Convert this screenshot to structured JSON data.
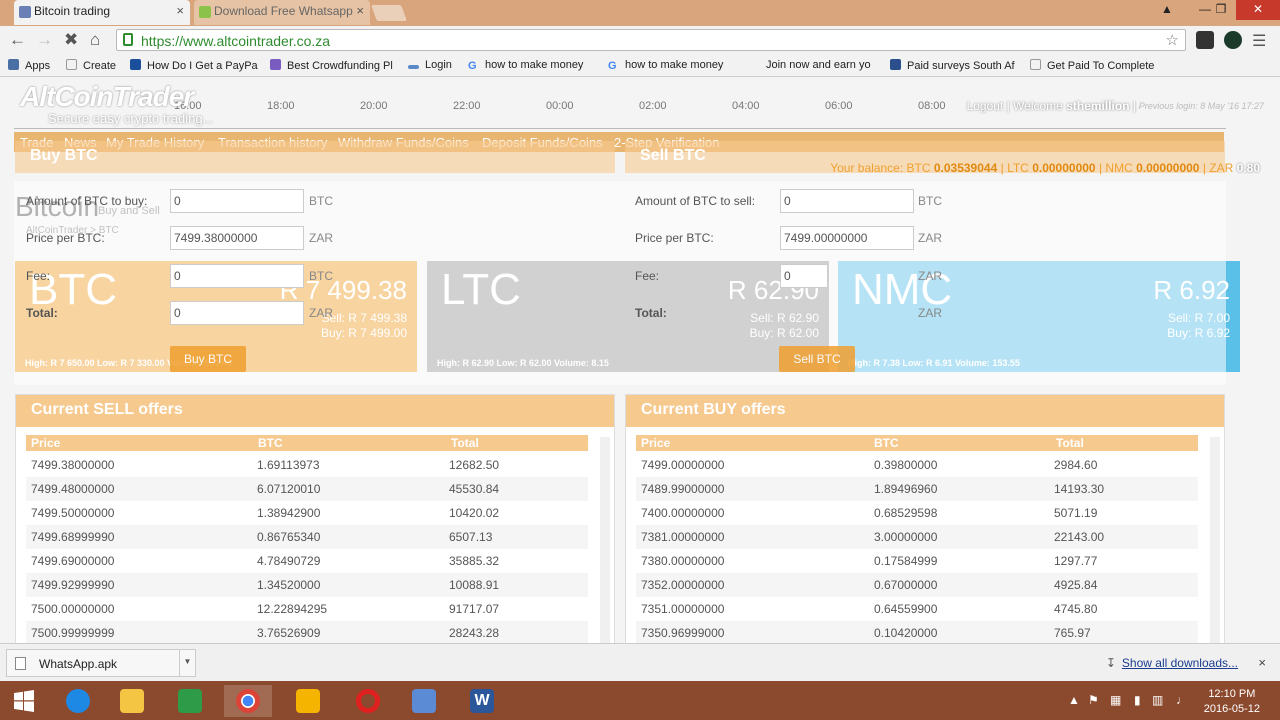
{
  "browser": {
    "tabs": [
      {
        "title": "Bitcoin trading",
        "active": true
      },
      {
        "title": "Download Free Whatsapp",
        "active": false
      }
    ],
    "close_glyph": "×",
    "url": "https://www.altcointrader.co.za",
    "bookmarks": [
      {
        "label": "Apps",
        "icon": "apps-icon"
      },
      {
        "label": "Create",
        "icon": "page-icon"
      },
      {
        "label": "How Do I Get a PayPa",
        "icon": "paypal-icon"
      },
      {
        "label": "Best Crowdfunding Pl",
        "icon": "star-icon"
      },
      {
        "label": "Login",
        "icon": "login-icon"
      },
      {
        "label": "how to make money",
        "icon": "google-icon"
      },
      {
        "label": "how to make money",
        "icon": "google-icon"
      },
      {
        "label": "Join now and earn yo",
        "icon": ""
      },
      {
        "label": "Paid surveys South Af",
        "icon": "survey-icon"
      },
      {
        "label": "Get Paid To Complete",
        "icon": "page-icon"
      }
    ]
  },
  "site": {
    "logo": "AltCoinTrader",
    "tagline": "Secure easy crypto trading...",
    "chart_ticks": [
      "16:00",
      "18:00",
      "20:00",
      "22:00",
      "00:00",
      "02:00",
      "04:00",
      "06:00",
      "08:00"
    ],
    "user_prefix": "Logout | Welcome",
    "username": "sthemillion",
    "user_suffix": "|",
    "last_login": "Previous login: 8 May '16 17:27",
    "menu": [
      "Trade",
      "News",
      "My Trade History",
      "Transaction history",
      "Withdraw Funds/Coins",
      "Deposit Funds/Coins",
      "2-Step Verification"
    ],
    "balance": {
      "prefix": "Your balance:",
      "btc_label": "BTC",
      "btc": "0.03539044",
      "ltc_label": "LTC",
      "ltc": "0.00000000",
      "nmc_label": "NMC",
      "nmc": "0.00000000",
      "zar_label": "ZAR",
      "zar": "0.80",
      "separator": "|"
    },
    "ghost": {
      "title": "Bitcoin",
      "subtitle": "Buy and Sell",
      "crumb": "AltCoinTrader > BTC"
    }
  },
  "buy_form": {
    "title": "Buy BTC",
    "amount_label": "Amount of BTC to buy:",
    "amount": "0",
    "amount_unit": "BTC",
    "price_label": "Price per BTC:",
    "price": "7499.38000000",
    "price_unit": "ZAR",
    "fee_label": "Fee:",
    "fee": "0",
    "fee_unit": "BTC",
    "total_label": "Total:",
    "total": "0",
    "total_unit": "ZAR",
    "button": "Buy BTC"
  },
  "sell_form": {
    "title": "Sell BTC",
    "amount_label": "Amount of BTC to sell:",
    "amount": "0",
    "amount_unit": "BTC",
    "price_label": "Price per BTC:",
    "price": "7499.00000000",
    "price_unit": "ZAR",
    "fee_label": "Fee:",
    "fee": "0",
    "fee_unit": "ZAR",
    "total_label": "Total:",
    "total": "0",
    "total_unit": "ZAR",
    "button": "Sell BTC"
  },
  "tiles": [
    {
      "symbol": "BTC",
      "price": "R 7 499.38",
      "sell": "Sell: R 7 499.38",
      "buy": "Buy: R 7 499.00",
      "stats": "High: R 7 650.00   Low: R 7 330.00   Volume: 550.46",
      "color": "#f0a030"
    },
    {
      "symbol": "LTC",
      "price": "R 62.90",
      "sell": "Sell: R 62.90",
      "buy": "Buy: R 62.00",
      "stats": "High: R 62.90   Low: R 62.00   Volume: 8.15",
      "color": "#999999"
    },
    {
      "symbol": "NMC",
      "price": "R 6.92",
      "sell": "Sell: R 7.00",
      "buy": "Buy: R 6.92",
      "stats": "High: R 7.38   Low: R 6.91   Volume: 153.55",
      "color": "#5bc0e8"
    }
  ],
  "sell_offers": {
    "title": "Current SELL offers",
    "columns": [
      "Price",
      "BTC",
      "Total"
    ],
    "rows": [
      [
        "7499.38000000",
        "1.69113973",
        "12682.50"
      ],
      [
        "7499.48000000",
        "6.07120010",
        "45530.84"
      ],
      [
        "7499.50000000",
        "1.38942900",
        "10420.02"
      ],
      [
        "7499.68999990",
        "0.86765340",
        "6507.13"
      ],
      [
        "7499.69000000",
        "4.78490729",
        "35885.32"
      ],
      [
        "7499.92999990",
        "1.34520000",
        "10088.91"
      ],
      [
        "7500.00000000",
        "12.22894295",
        "91717.07"
      ],
      [
        "7500.99999999",
        "3.76526909",
        "28243.28"
      ]
    ]
  },
  "buy_offers": {
    "title": "Current BUY offers",
    "columns": [
      "Price",
      "BTC",
      "Total"
    ],
    "rows": [
      [
        "7499.00000000",
        "0.39800000",
        "2984.60"
      ],
      [
        "7489.99000000",
        "1.89496960",
        "14193.30"
      ],
      [
        "7400.00000000",
        "0.68529598",
        "5071.19"
      ],
      [
        "7381.00000000",
        "3.00000000",
        "22143.00"
      ],
      [
        "7380.00000000",
        "0.17584999",
        "1297.77"
      ],
      [
        "7352.00000000",
        "0.67000000",
        "4925.84"
      ],
      [
        "7351.00000000",
        "0.64559900",
        "4745.80"
      ],
      [
        "7350.96999000",
        "0.10420000",
        "765.97"
      ]
    ]
  },
  "downloads": {
    "file": "WhatsApp.apk",
    "arrow_glyph": "▼",
    "show_all": "Show all downloads...",
    "close_glyph": "×"
  },
  "taskbar": {
    "time": "12:10 PM",
    "date": "2016-05-12",
    "apps": [
      "windows-start-icon",
      "internet-explorer-icon",
      "file-explorer-icon",
      "excel-icon",
      "chrome-icon",
      "bing-icon",
      "opera-icon",
      "network-icon",
      "word-icon"
    ]
  }
}
